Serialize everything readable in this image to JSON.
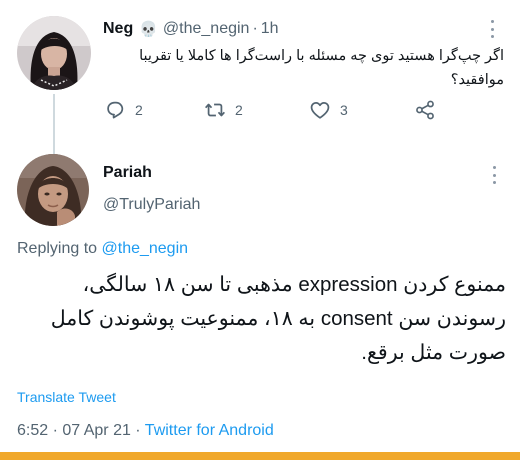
{
  "parent_tweet": {
    "display_name": "Neg",
    "emoji": "💀",
    "handle": "@the_negin",
    "separator": "·",
    "time": "1h",
    "text": "اگر چپ‌گرا هستید توی چه مسئله با راست‌گرا ها کاملا یا تقریبا موافقید؟",
    "reply_count": "2",
    "retweet_count": "2",
    "like_count": "3"
  },
  "reply_tweet": {
    "display_name": "Pariah",
    "handle": "@TrulyPariah",
    "replying_label": "Replying to",
    "replying_to": "@the_negin",
    "text": "ممنوع کردن expression مذهبی تا سن ۱۸ سالگی، رسوندن سن consent به ۱۸، ممنوعیت پوشوندن کامل صورت مثل برقع.",
    "translate_label": "Translate Tweet",
    "timestamp": "6:52 · 07 Apr 21 · ",
    "client": "Twitter for Android"
  },
  "colors": {
    "link": "#1d9bf0",
    "muted": "#536471",
    "text": "#0f1419",
    "thread_line": "#cfd9de",
    "bottom_bar": "#f0a82b"
  },
  "icons": {
    "reply": "reply-icon",
    "retweet": "retweet-icon",
    "like": "heart-icon",
    "share": "share-icon",
    "more": "more-options-icon"
  }
}
